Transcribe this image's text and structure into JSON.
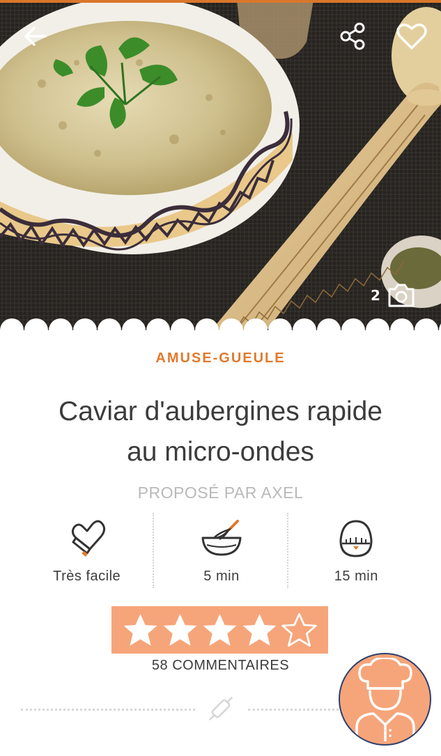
{
  "header": {
    "back_icon": "arrow-left-icon",
    "share_icon": "share-icon",
    "favorite_icon": "heart-outline-icon",
    "photo_count": "2",
    "camera_icon": "camera-icon"
  },
  "recipe": {
    "category": "AMUSE-GUEULE",
    "title_line1": "Caviar d'aubergines rapide",
    "title_line2": "au micro-ondes",
    "author": "PROPOSÉ PAR AXEL"
  },
  "info": [
    {
      "icon": "oven-mitt-icon",
      "label": "Très facile"
    },
    {
      "icon": "whisk-bowl-icon",
      "label": "5 min"
    },
    {
      "icon": "egg-timer-icon",
      "label": "15 min"
    }
  ],
  "rating": {
    "value": 4,
    "max": 5
  },
  "comments": {
    "count": "58",
    "label": "COMMENTAIRES"
  },
  "divider_icon": "rolling-pin-icon",
  "fab_icon": "chef-icon",
  "colors": {
    "accent": "#e07a2e",
    "rating_bg": "#f6a57a",
    "text": "#3c3c3c",
    "muted": "#b9b9b9"
  }
}
